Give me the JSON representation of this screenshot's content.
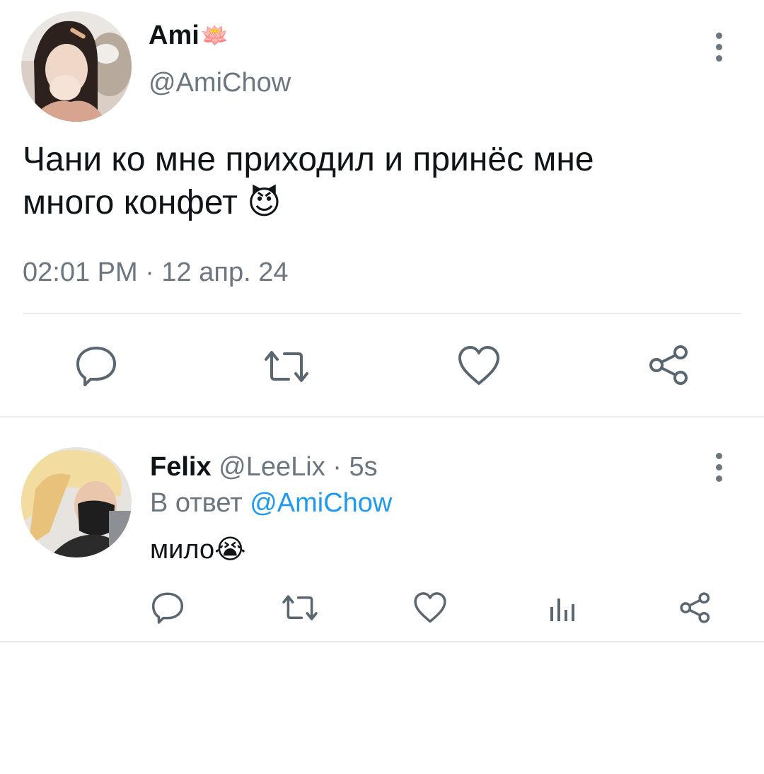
{
  "tweet": {
    "name": "Ami",
    "name_emoji": "🪷",
    "handle": "@AmiChow",
    "text_line1": "Чани ко мне приходил и принёс мне",
    "text_line2": "много конфет",
    "text_emoji": "😈",
    "timestamp": "02:01 PM · 12 апр. 24",
    "icons": [
      "reply-icon",
      "retweet-icon",
      "like-icon",
      "share-icon"
    ]
  },
  "reply": {
    "name": "Felix",
    "handle": "@LeeLix",
    "time": " · 5s",
    "reply_prefix": "В ответ ",
    "reply_to": "@AmiChow",
    "text": "мило",
    "text_emoji": "😭",
    "icons": [
      "reply-icon",
      "retweet-icon",
      "like-icon",
      "analytics-icon",
      "share-icon"
    ]
  },
  "colors": {
    "text": "#0f1419",
    "secondary": "#6b7680",
    "link": "#1d9bf0",
    "separator": "#e8ecef"
  }
}
